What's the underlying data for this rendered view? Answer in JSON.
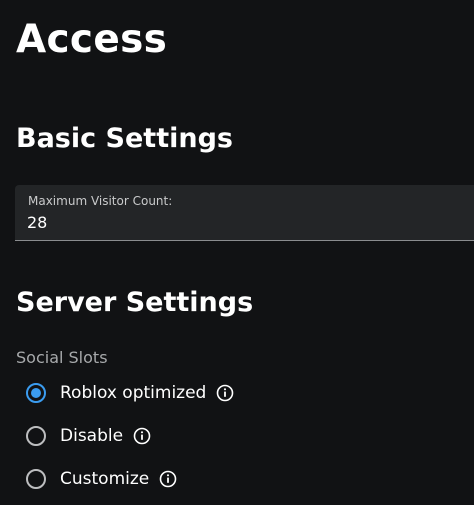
{
  "page": {
    "title": "Access"
  },
  "basic_settings": {
    "title": "Basic Settings",
    "max_visitors": {
      "label": "Maximum Visitor Count:",
      "value": "28"
    }
  },
  "server_settings": {
    "title": "Server Settings",
    "social_slots": {
      "label": "Social Slots",
      "options": [
        {
          "label": "Roblox optimized",
          "selected": true,
          "icon": "info-icon"
        },
        {
          "label": "Disable",
          "selected": false,
          "icon": "info-icon"
        },
        {
          "label": "Customize",
          "selected": false,
          "icon": "info-icon"
        }
      ]
    }
  },
  "colors": {
    "background": "#111214",
    "field_background": "#232527",
    "accent": "#3b9cf0",
    "muted_text": "#a7a9ab"
  }
}
